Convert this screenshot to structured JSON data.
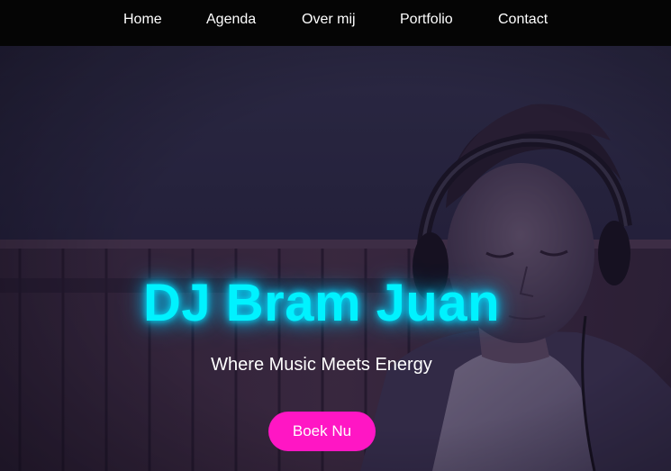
{
  "nav": {
    "items": [
      {
        "label": "Home"
      },
      {
        "label": "Agenda"
      },
      {
        "label": "Over mij"
      },
      {
        "label": "Portfolio"
      },
      {
        "label": "Contact"
      }
    ]
  },
  "hero": {
    "title": "DJ Bram Juan",
    "subtitle": "Where Music Meets Energy",
    "cta_label": "Boek Nu"
  },
  "colors": {
    "nav_background": "#050505",
    "title_glow": "#00f2ff",
    "cta_background": "#ff16c4",
    "text": "#ffffff"
  }
}
